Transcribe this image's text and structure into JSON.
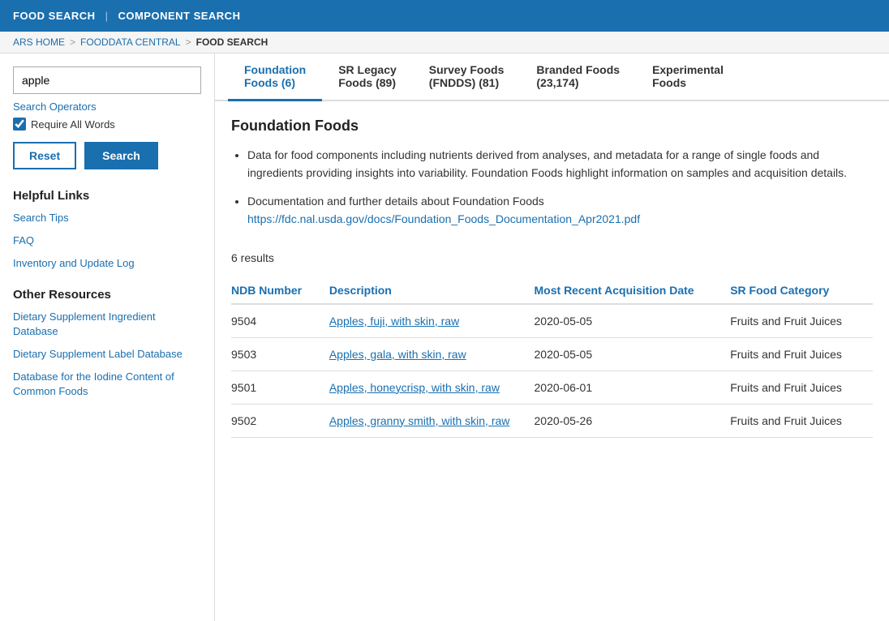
{
  "topNav": {
    "foodSearch": "FOOD SEARCH",
    "divider": "|",
    "componentSearch": "COMPONENT SEARCH"
  },
  "breadcrumb": {
    "arsHome": "ARS HOME",
    "sep1": ">",
    "foodDataCentral": "FOODDATA CENTRAL",
    "sep2": ">",
    "current": "FOOD SEARCH"
  },
  "sidebar": {
    "searchValue": "apple",
    "searchPlaceholder": "",
    "searchOperatorsLabel": "Search Operators",
    "requireAllWords": "Require All Words",
    "resetLabel": "Reset",
    "searchLabel": "Search",
    "helpfulLinks": {
      "title": "Helpful Links",
      "items": [
        {
          "label": "Search Tips",
          "href": "#"
        },
        {
          "label": "FAQ",
          "href": "#"
        },
        {
          "label": "Inventory and Update Log",
          "href": "#"
        }
      ]
    },
    "otherResources": {
      "title": "Other Resources",
      "items": [
        {
          "label": "Dietary Supplement Ingredient Database",
          "href": "#"
        },
        {
          "label": "Dietary Supplement Label Database",
          "href": "#"
        },
        {
          "label": "Database for the Iodine Content of Common Foods",
          "href": "#"
        }
      ]
    }
  },
  "tabs": [
    {
      "id": "foundation",
      "label": "Foundation Foods (6)",
      "active": true
    },
    {
      "id": "srlegacy",
      "label": "SR Legacy Foods (89)",
      "active": false
    },
    {
      "id": "survey",
      "label": "Survey Foods (FNDDS) (81)",
      "active": false
    },
    {
      "id": "branded",
      "label": "Branded Foods (23,174)",
      "active": false
    },
    {
      "id": "experimental",
      "label": "Experimental Foods",
      "active": false
    }
  ],
  "foundationFoods": {
    "title": "Foundation Foods",
    "bulletPoints": [
      "Data for food components including nutrients derived from analyses, and metadata for a range of single foods and ingredients providing insights into variability. Foundation Foods highlight information on samples and acquisition details.",
      "Documentation and further details about Foundation Foods"
    ],
    "docLink": "https://fdc.nal.usda.gov/docs/Foundation_Foods_Documentation_Apr2021.pdf",
    "docLinkText": "https://fdc.nal.usda.gov/docs/Foundation_Foods_Documentation_Apr2021.pdf",
    "resultsCount": "6 results",
    "tableHeaders": {
      "ndbNumber": "NDB Number",
      "description": "Description",
      "mostRecentAcquisitionDate": "Most Recent Acquisition Date",
      "srFoodCategory": "SR Food Category"
    },
    "rows": [
      {
        "ndb": "9504",
        "description": "Apples, fuji, with skin, raw",
        "date": "2020-05-05",
        "category": "Fruits and Fruit Juices"
      },
      {
        "ndb": "9503",
        "description": "Apples, gala, with skin, raw",
        "date": "2020-05-05",
        "category": "Fruits and Fruit Juices"
      },
      {
        "ndb": "9501",
        "description": "Apples, honeycrisp, with skin, raw",
        "date": "2020-06-01",
        "category": "Fruits and Fruit Juices"
      },
      {
        "ndb": "9502",
        "description": "Apples, granny smith, with skin, raw",
        "date": "2020-05-26",
        "category": "Fruits and Fruit Juices"
      }
    ]
  }
}
